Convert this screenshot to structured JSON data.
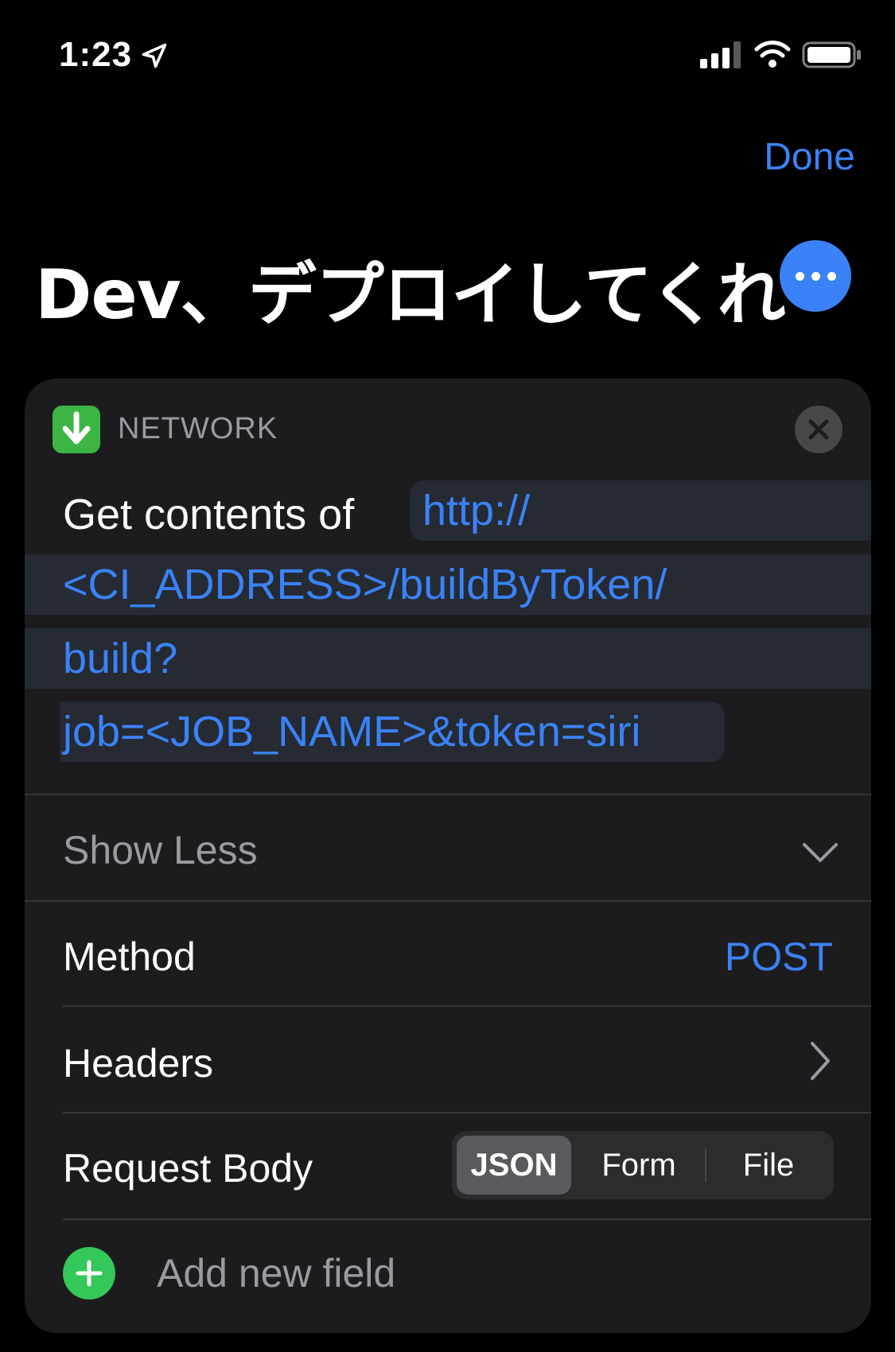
{
  "status_bar": {
    "time": "1:23"
  },
  "nav": {
    "done_label": "Done"
  },
  "shortcut": {
    "title": "Dev、デプロイしてくれ"
  },
  "action": {
    "category": "NETWORK",
    "prefix": "Get contents of",
    "url_lines": [
      "http://",
      "<CI_ADDRESS>/buildByToken/",
      "build?",
      "job=<JOB_NAME>&token=siri"
    ],
    "show_less_label": "Show Less",
    "method_label": "Method",
    "method_value": "POST",
    "headers_label": "Headers",
    "request_body_label": "Request Body",
    "request_body_options": [
      "JSON",
      "Form",
      "File"
    ],
    "request_body_selected": "JSON",
    "add_field_label": "Add new field"
  },
  "colors": {
    "accent": "#3b82f6",
    "network_icon": "#3cb544",
    "add_button": "#34c759",
    "card_background": "#1c1c1e"
  }
}
